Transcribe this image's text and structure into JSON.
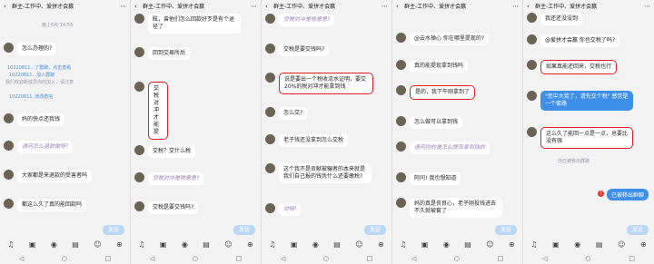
{
  "header": {
    "title": "群主-工作中、爱拼才会赢"
  },
  "input": {
    "send_label": "发送"
  },
  "panels": [
    {
      "sys1": "10220811...了群聊，点击查看",
      "sys2": "10220811...加入群聊",
      "sys3": "我们欢迎新成员你的加入，请注意",
      "sys4": "10220811..修改群名",
      "msgs": [
        "怎么办理的?",
        "妈的快点还我钱",
        "请问怎么退款做呀?",
        "大家都是来退款的受害者吗",
        "都这么久了真的能回款吗"
      ]
    },
    {
      "msgs": [
        "眩，曾他们怎么回款好歹是有个途径了",
        "回到交易所后",
        "交税 对冲",
        "才能提",
        "交税？交什么税",
        "交税对冲是啥意思?",
        "交税是要交钱吗?"
      ]
    },
    {
      "msgs": [
        "交税对冲是啥意思?",
        "交税是要交钱吗?",
        "说是要出一个税收流水证明，要交20%的税对冲才能拿到钱",
        "怎么交?",
        "老子钱还没拿到怎么交税",
        "这个我不是贡献被骗者的本来就是我们自己报的钱凭什么还要缴税?",
        "对呀!"
      ]
    },
    {
      "msgs": [
        "@云水禅心 你在哪里提现的?",
        "真的能提现拿到钱吗",
        "是的，我下午刚拿到了",
        "怎么做可以拿到钱",
        "请问你的是怎么提现拿到钱的",
        "阿问! 我也想知道",
        "妈的真是丧良心，老子刚投钱进去不久就被套了"
      ]
    },
    {
      "msgs": [
        "我还还没没到",
        "@爱拼才会赢 你也交税了吗?",
        "如果真能还回来，交税也行",
        "\"您中大奖了，请先交个税\" 感觉是一个套路",
        "这么久了能回一点是一点，总要比没有强",
        "你已被移出群聊",
        "已被移出群聊"
      ]
    }
  ]
}
